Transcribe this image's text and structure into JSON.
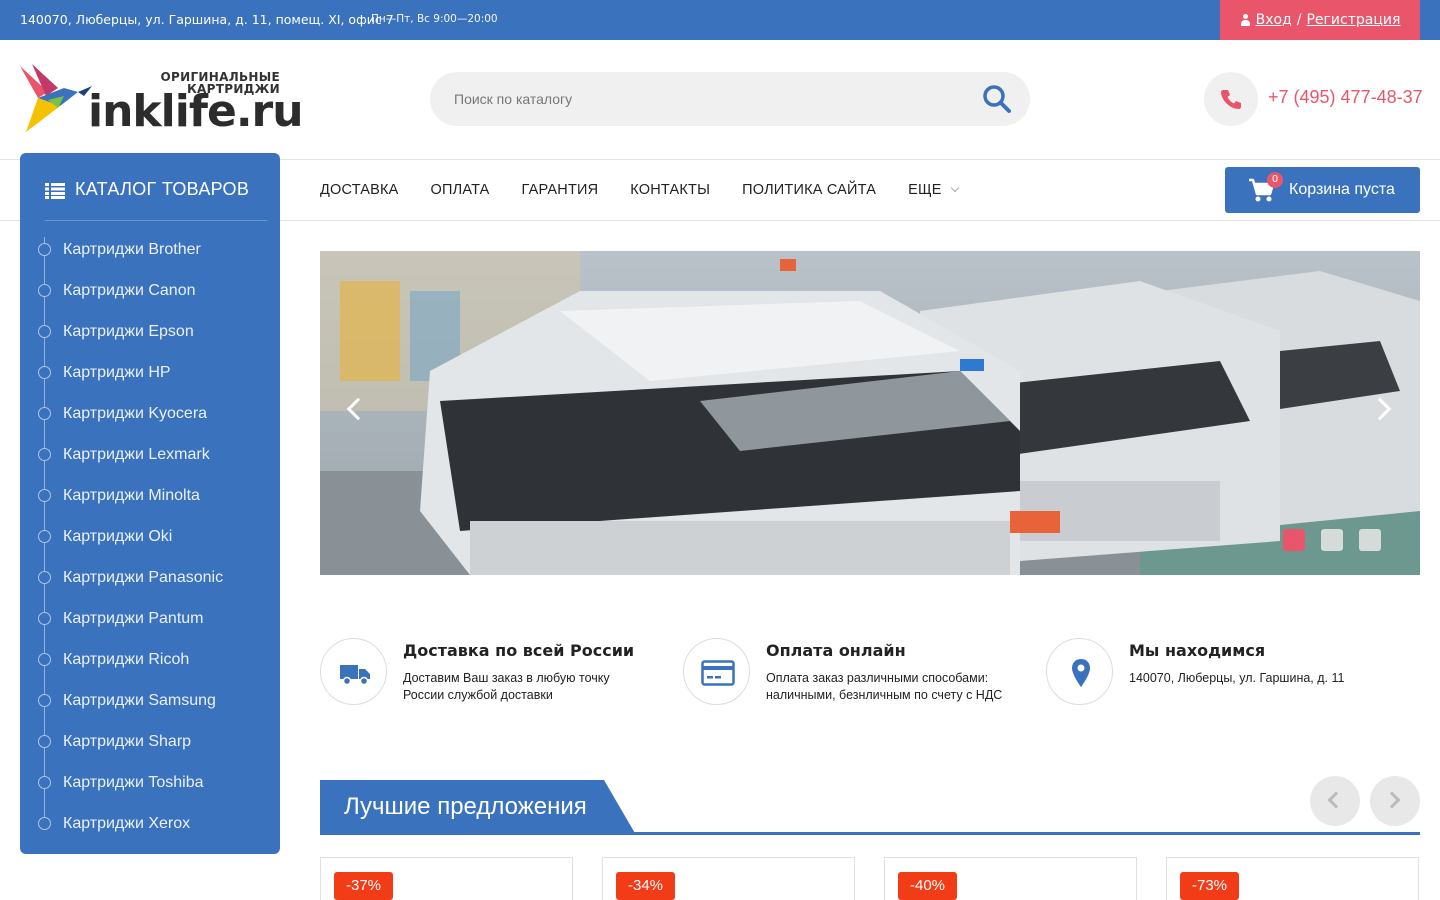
{
  "topbar": {
    "address": "140070, Люберцы, ул. Гаршина, д. 11, помещ. XI, офис 7",
    "hours": "Пн—Пт, Вс 9:00—20:00",
    "login": "Вход",
    "separator": "/",
    "register": "Регистрация"
  },
  "logo": {
    "tagline_1": "ОРИГИНАЛЬНЫЕ",
    "tagline_2": "КАРТРИДЖИ",
    "wordmark": "inklife.ru"
  },
  "search": {
    "placeholder": "Поиск по каталогу",
    "icon": "search-icon"
  },
  "phone": {
    "number": "+7 (495) 477-48-37",
    "icon": "phone-icon"
  },
  "catalog": {
    "title": "КАТАЛОГ ТОВАРОВ",
    "items": [
      "Картриджи Brother",
      "Картриджи Canon",
      "Картриджи Epson",
      "Картриджи HP",
      "Картриджи Kyocera",
      "Картриджи Lexmark",
      "Картриджи Minolta",
      "Картриджи Oki",
      "Картриджи Panasonic",
      "Картриджи Pantum",
      "Картриджи Ricoh",
      "Картриджи Samsung",
      "Картриджи Sharp",
      "Картриджи Toshiba",
      "Картриджи Xerox"
    ]
  },
  "nav": {
    "delivery": "ДОСТАВКА",
    "payment": "ОПЛАТА",
    "warranty": "ГАРАНТИЯ",
    "contacts": "КОНТАКТЫ",
    "policy": "ПОЛИТИКА САЙТА",
    "more": "ЕЩЕ"
  },
  "cart": {
    "count": "0",
    "label": "Корзина пуста"
  },
  "banner": {
    "slides_total": 3,
    "active_slide": 1
  },
  "features": [
    {
      "title": "Доставка по всей России",
      "text": "Доставим Ваш заказ в любую точку России службой доставки",
      "icon": "truck-icon"
    },
    {
      "title": "Оплата онлайн",
      "text": "Оплата заказ различными способами: наличными, безнличным по счету с НДС",
      "icon": "credit-card-icon"
    },
    {
      "title": "Мы находимся",
      "text": "140070, Люберцы, ул. Гаршина, д. 11",
      "icon": "map-pin-icon"
    }
  ],
  "offers": {
    "title": "Лучшие предложения",
    "discounts": [
      "-37%",
      "-34%",
      "-40%",
      "-73%"
    ]
  },
  "colors": {
    "primary_blue": "#3a72bd",
    "accent_red": "#e9566b",
    "discount_red": "#f23c17"
  }
}
